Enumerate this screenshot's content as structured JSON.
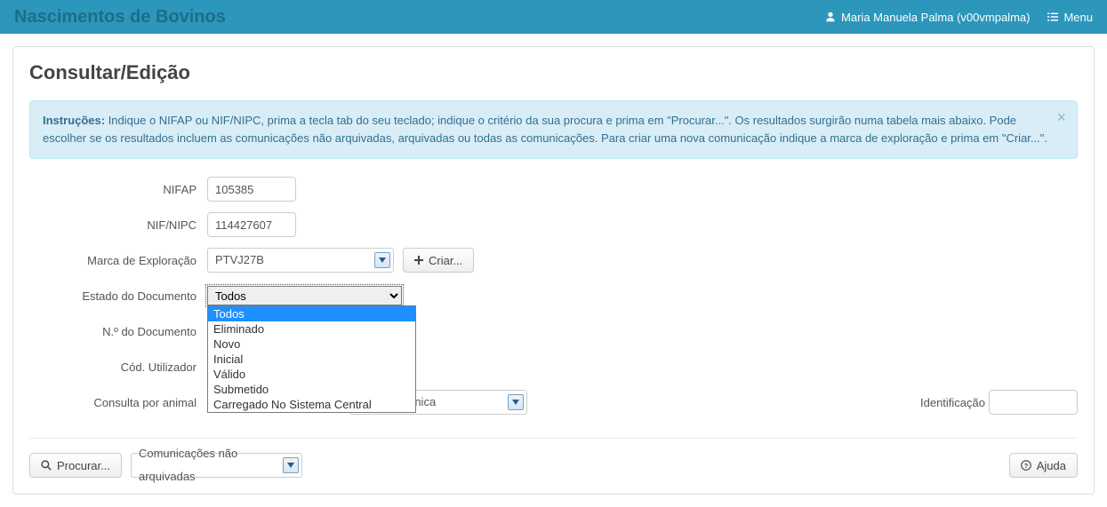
{
  "topbar": {
    "app_title": "Nascimentos de Bovinos",
    "user_label": "Maria Manuela Palma (v00vmpalma)",
    "menu_label": "Menu"
  },
  "page": {
    "title": "Consultar/Edição"
  },
  "alert": {
    "prefix": "Instruções:",
    "body": " Indique o NIFAP ou NIF/NIPC, prima a tecla tab do seu teclado; indique o critério da sua procura e prima em \"Procurar...\". Os resultados surgirão numa tabela mais abaixo. Pode escolher se os resultados incluem as comunicações não arquivadas, arquivadas ou todas as comunicações. Para criar uma nova comunicação indique a marca de exploração e prima em \"Criar...\".",
    "close": "×"
  },
  "form": {
    "nifap": {
      "label": "NIFAP",
      "value": "105385"
    },
    "nif": {
      "label": "NIF/NIPC",
      "value": "114427607"
    },
    "marca": {
      "label": "Marca de Exploração",
      "value": "PTVJ27B"
    },
    "criar_btn": "Criar...",
    "estado": {
      "label": "Estado do Documento",
      "selected": "Todos",
      "options": [
        "Todos",
        "Eliminado",
        "Novo",
        "Inicial",
        "Válido",
        "Submetido",
        "Carregado No Sistema Central"
      ]
    },
    "ndoc": {
      "label": "N.º do Documento"
    },
    "codutil": {
      "label": "Cód. Utilizador"
    },
    "consulta_animal": {
      "label": "Consulta por animal"
    },
    "tipo_ident": {
      "partial_label": "ação eletrónica"
    },
    "identificacao": {
      "label": "Identificação"
    }
  },
  "footer": {
    "procurar_btn": "Procurar...",
    "arch_select": "Comunicações não arquivadas",
    "ajuda_btn": "Ajuda"
  }
}
